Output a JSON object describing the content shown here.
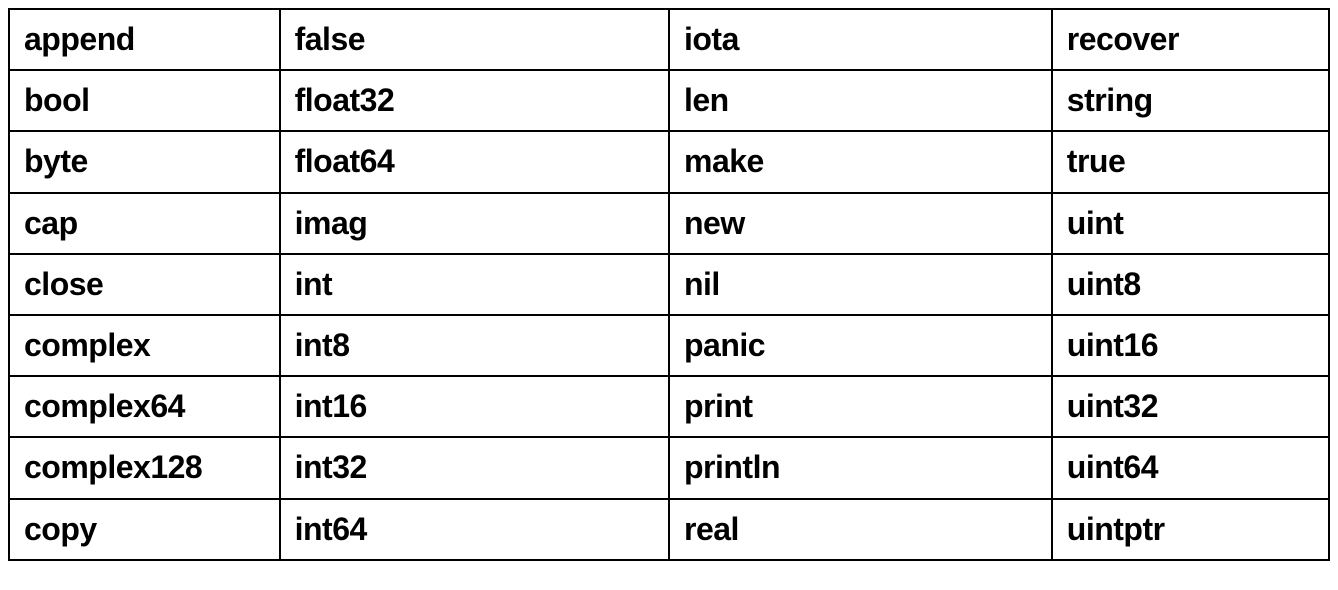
{
  "chart_data": {
    "type": "table",
    "title": "",
    "columns": 4,
    "rows": [
      [
        "append",
        "false",
        "iota",
        "recover"
      ],
      [
        "bool",
        "float32",
        "len",
        "string"
      ],
      [
        "byte",
        "float64",
        "make",
        "true"
      ],
      [
        "cap",
        "imag",
        "new",
        "uint"
      ],
      [
        "close",
        "int",
        "nil",
        "uint8"
      ],
      [
        "complex",
        "int8",
        "panic",
        "uint16"
      ],
      [
        "complex64",
        "int16",
        "print",
        "uint32"
      ],
      [
        "complex128",
        "int32",
        "println",
        "uint64"
      ],
      [
        "copy",
        "int64",
        "real",
        "uintptr"
      ]
    ]
  }
}
